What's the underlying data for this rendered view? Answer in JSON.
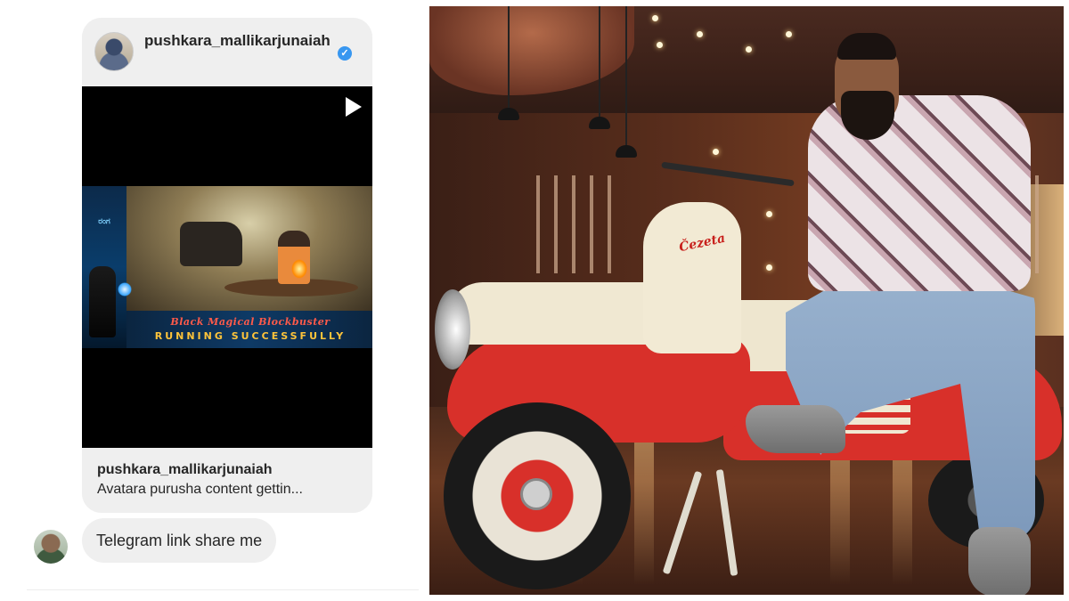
{
  "post": {
    "header_username": "pushkara_mallikarjunaiah",
    "verified_icon": "verified-check-icon",
    "play_icon": "play-icon",
    "banner": {
      "poster_logo": "ರಂಗ",
      "line1": "Black Magical Blockbuster",
      "line2": "RUNNING SUCCESSFULLY"
    },
    "footer_username": "pushkara_mallikarjunaiah",
    "caption": "Avatara purusha content gettin..."
  },
  "message": {
    "text": "Telegram link share me"
  },
  "photo": {
    "scooter_badge": "Čezeta"
  },
  "colors": {
    "bubble": "#efefef",
    "text": "#262626",
    "verified": "#3897f0",
    "scooter_red": "#d8302a",
    "scooter_cream": "#eee6cf"
  }
}
